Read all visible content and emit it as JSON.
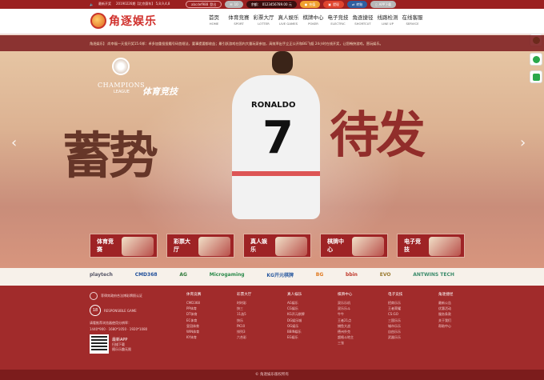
{
  "topbar": {
    "announcement_label": "最新开奖",
    "lottery_info": "20190226期【北京赛车】 5,8,9,4,8",
    "username": "abcdef988",
    "logout": "登出",
    "messages": "10",
    "balance_label": "余额：",
    "balance_value": "0123456789.00 元",
    "recharge": "充值",
    "withdraw": "提现",
    "transfer": "转账",
    "app": "APP下载"
  },
  "brand": {
    "name": "角逐娱乐"
  },
  "nav": [
    {
      "zh": "首页",
      "en": "HOME"
    },
    {
      "zh": "体育竞赛",
      "en": "SPORT"
    },
    {
      "zh": "彩票大厅",
      "en": "LOTTER"
    },
    {
      "zh": "真人娱乐",
      "en": "LIVE GAMES"
    },
    {
      "zh": "棋牌中心",
      "en": "POKER"
    },
    {
      "zh": "电子竞技",
      "en": "ELECTRIC"
    },
    {
      "zh": "角逐捷径",
      "en": "SHORTCUT"
    },
    {
      "zh": "线路检测",
      "en": "LINE UP"
    },
    {
      "zh": "在线客服",
      "en": "SERVICE"
    }
  ],
  "ticker": {
    "text": "角逐娱乐】 尚幸福一天投开奖15.6郑：卓多加重投投籍号码首规法，要事提要都收益；最引跃游戏在国内大量玩家参加，高效率出手立正公开和BG飞艇 24小时在线开奖，让您畅快游戏，营玩娱乐。"
  },
  "hero": {
    "ucl_title": "CHAMPIONS",
    "ucl_sub": "LEAGUE",
    "sport_tag": "体育竞技",
    "player_name": "RONALDO",
    "player_number": "7",
    "brush_left": "蓄势",
    "brush_right": "待发"
  },
  "tiles": [
    {
      "zh": "体育竞赛"
    },
    {
      "zh": "彩票大厅"
    },
    {
      "zh": "真人娱乐"
    },
    {
      "zh": "棋牌中心"
    },
    {
      "zh": "电子竞技"
    }
  ],
  "partners": [
    "playtech",
    "CMD368",
    "AG",
    "Microgaming",
    "KG开元棋牌",
    "BG",
    "bbin",
    "EVO",
    "ANTWINS TECH"
  ],
  "footer": {
    "gov": "菲律宾政府合法博彩牌照认证",
    "responsible": "RESPONSIBLE GAME",
    "browser_note": "请看推荐浏览器使用分辨率：",
    "resolutions": "1440*900 · 1680*1050 · 1920*1080",
    "app_title": "最新APP",
    "app_scan": "扫描下载",
    "app_note": "随乐乐趣无限",
    "columns": [
      {
        "h": "体育竞赛",
        "items": [
          "CMD368",
          "PP体育",
          "DT体育",
          "EC体育",
          "皇冠体育",
          "WIN体育",
          "KY体育"
        ]
      },
      {
        "h": "彩票大厅",
        "items": [
          "时时彩",
          "快三",
          "11选5",
          "快乐",
          "PK10",
          "排列3",
          "六合彩"
        ]
      },
      {
        "h": "真人娱乐",
        "items": [
          "AG娱乐",
          "CG娱乐",
          "KG开元棋牌",
          "DG娱乐城",
          "OG娱乐",
          "BBIN娱乐",
          "EG娱乐"
        ]
      },
      {
        "h": "棋牌中心",
        "items": [
          "双乐乐机",
          "双乐乐斗",
          "牛牛",
          "王者21点",
          "捕鱼大战",
          "德州扑克",
          "超格斗地主",
          "三张"
        ]
      },
      {
        "h": "电子竞技",
        "items": [
          "招商乐乐",
          "王者荣耀",
          "CS:GO",
          "三国乐乐",
          "城市乐乐",
          "自由乐乐",
          "武器乐乐"
        ]
      },
      {
        "h": "角逐捷径",
        "items": [
          "最新公告",
          "优惠活动",
          "服务条款",
          "关于我们",
          "帮助中心"
        ]
      }
    ],
    "copyright": "© 角逐娱乐版权所有"
  }
}
